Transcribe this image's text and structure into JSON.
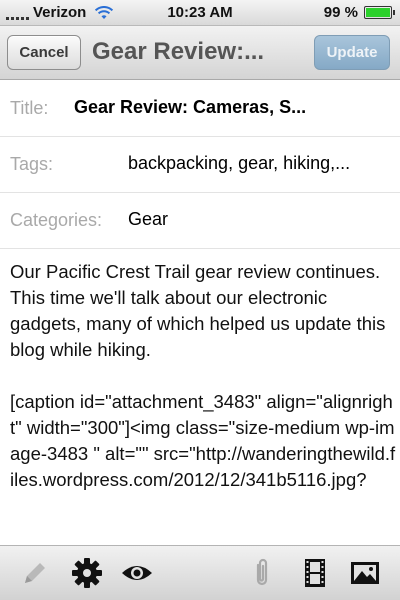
{
  "status_bar": {
    "carrier": "Verizon",
    "time": "10:23 AM",
    "battery": "99 %",
    "battery_level": 0.99
  },
  "nav": {
    "cancel_label": "Cancel",
    "title": "Gear Review:...",
    "update_label": "Update"
  },
  "fields": {
    "title_label": "Title:",
    "title_value": "Gear Review: Cameras, S...",
    "tags_label": "Tags:",
    "tags_value": "backpacking, gear, hiking,...",
    "categories_label": "Categories:",
    "categories_value": "Gear"
  },
  "body": {
    "paragraph": "Our Pacific Crest Trail gear review continues. This time we'll talk about our electronic gadgets, many of which helped us update this blog while hiking.",
    "code": "[caption id=\"attachment_3483\" align=\"alignright\" width=\"300\"]<img class=\"size-medium wp-image-3483 \" alt=\"\" src=\"http://wanderingthewild.files.wordpress.com/2012/12/341b5116.jpg?"
  },
  "toolbar": {
    "icons": [
      "pencil-icon",
      "gear-icon",
      "eye-icon",
      "paperclip-icon",
      "film-icon",
      "image-icon"
    ]
  }
}
